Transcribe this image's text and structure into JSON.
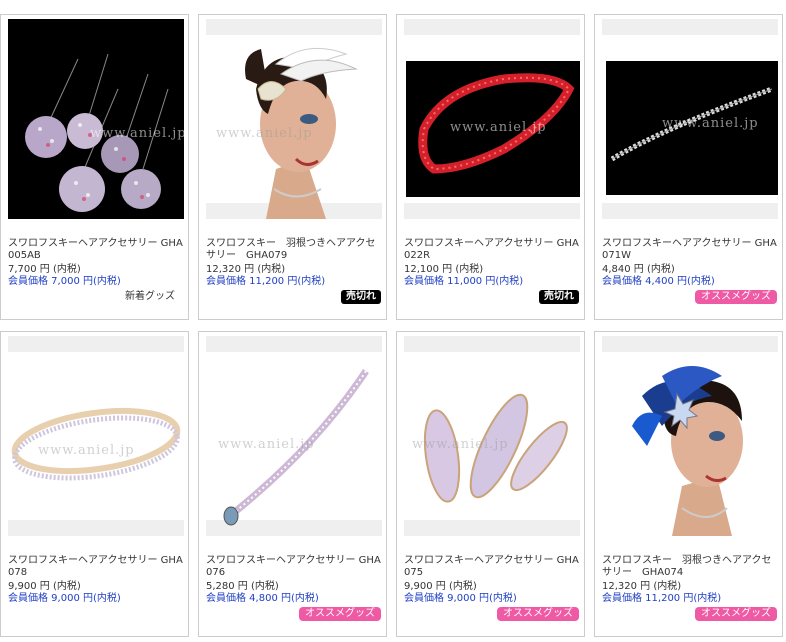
{
  "watermark": "www.aniel.jp",
  "products": [
    {
      "name": "スワロフスキーヘアアクセサリー GHA005AB",
      "price": "7,700 円 (内税)",
      "member": "会員価格 7,000 円(内税)",
      "badge": "新着グッズ",
      "badge_type": "new"
    },
    {
      "name": "スワロフスキー　羽根つきヘアアクセサリー　GHA079",
      "price": "12,320 円 (内税)",
      "member": "会員価格 11,200 円(内税)",
      "badge": "売切れ",
      "badge_type": "sold"
    },
    {
      "name": "スワロフスキーヘアアクセサリー GHA022R",
      "price": "12,100 円 (内税)",
      "member": "会員価格 11,000 円(内税)",
      "badge": "売切れ",
      "badge_type": "sold"
    },
    {
      "name": "スワロフスキーヘアアクセサリー GHA071W",
      "price": "4,840 円 (内税)",
      "member": "会員価格 4,400 円(内税)",
      "badge": "オススメグッズ",
      "badge_type": "rec"
    },
    {
      "name": "スワロフスキーヘアアクセサリー GHA078",
      "price": "9,900 円 (内税)",
      "member": "会員価格 9,000 円(内税)",
      "badge": "",
      "badge_type": "none"
    },
    {
      "name": "スワロフスキーヘアアクセサリー GHA076",
      "price": "5,280 円 (内税)",
      "member": "会員価格 4,800 円(内税)",
      "badge": "オススメグッズ",
      "badge_type": "rec"
    },
    {
      "name": "スワロフスキーヘアアクセサリー GHA075",
      "price": "9,900 円 (内税)",
      "member": "会員価格 9,000 円(内税)",
      "badge": "オススメグッズ",
      "badge_type": "rec"
    },
    {
      "name": "スワロフスキー　羽根つきヘアアクセサリー　GHA074",
      "price": "12,320 円 (内税)",
      "member": "会員価格 11,200 円(内税)",
      "badge": "オススメグッズ",
      "badge_type": "rec"
    }
  ]
}
